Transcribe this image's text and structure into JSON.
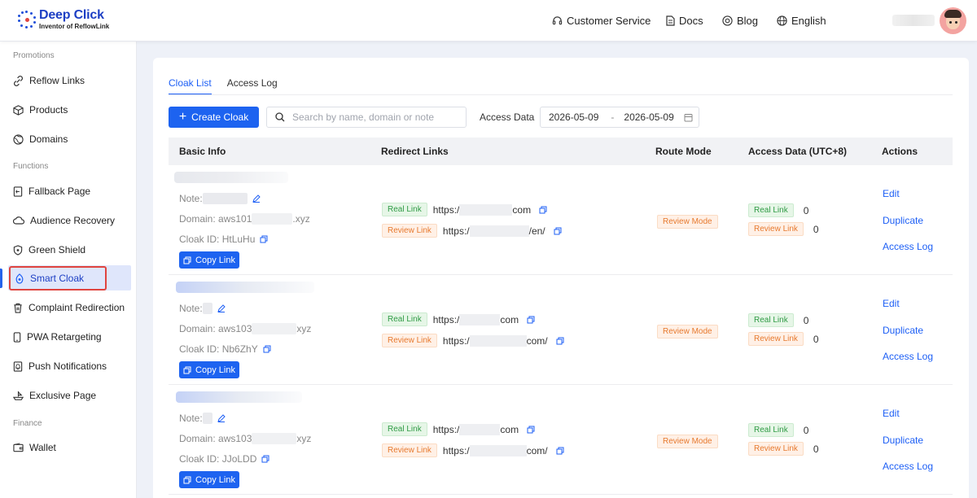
{
  "header": {
    "logo_title": "Deep Click",
    "logo_subtitle": "Inventor of ReflowLink",
    "nav": {
      "customer_service": "Customer Service",
      "docs": "Docs",
      "blog": "Blog",
      "language": "English"
    }
  },
  "sidebar": {
    "sections": {
      "promotions": "Promotions",
      "functions": "Functions",
      "finance": "Finance"
    },
    "items": [
      {
        "label": "Reflow Links",
        "icon": "link-icon"
      },
      {
        "label": "Products",
        "icon": "box-icon"
      },
      {
        "label": "Domains",
        "icon": "globe-icon"
      },
      {
        "label": "Fallback Page",
        "icon": "page-icon"
      },
      {
        "label": "Audience Recovery",
        "icon": "cloud-icon"
      },
      {
        "label": "Green Shield",
        "icon": "shield-icon"
      },
      {
        "label": "Smart Cloak",
        "icon": "cloak-icon",
        "active": true
      },
      {
        "label": "Complaint Redirection",
        "icon": "trash-icon"
      },
      {
        "label": "PWA Retargeting",
        "icon": "phone-icon"
      },
      {
        "label": "Push Notifications",
        "icon": "bell-icon"
      },
      {
        "label": "Exclusive Page",
        "icon": "ship-icon"
      },
      {
        "label": "Wallet",
        "icon": "wallet-icon"
      }
    ]
  },
  "main": {
    "tabs": [
      "Cloak List",
      "Access Log"
    ],
    "create_button": "Create Cloak",
    "search_placeholder": "Search by name, domain or note",
    "access_data_label": "Access Data",
    "date_start": "2026-05-09",
    "date_sep": "-",
    "date_end": "2026-05-09",
    "columns": [
      "Basic Info",
      "Redirect Links",
      "Route Mode",
      "Access Data (UTC+8)",
      "Actions"
    ],
    "labels": {
      "note": "Note:",
      "domain": "Domain:",
      "cloak_id": "Cloak ID:",
      "copy_link": "Copy Link",
      "real_link": "Real Link",
      "review_link": "Review Link",
      "route_mode": "Review Mode",
      "edit": "Edit",
      "duplicate": "Duplicate",
      "access_log": "Access Log"
    },
    "rows": [
      {
        "domain_prefix": "aws101",
        "domain_suffix": ".xyz",
        "cloak_id": "HtLuHu",
        "real_url_prefix": "https:/",
        "real_url_suffix": "com",
        "review_url_prefix": "https:/",
        "review_url_suffix": "/en/",
        "real_count": "0",
        "review_count": "0"
      },
      {
        "domain_prefix": "aws103",
        "domain_suffix": "xyz",
        "cloak_id": "Nb6ZhY",
        "real_url_prefix": "https:/",
        "real_url_suffix": "com",
        "review_url_prefix": "https:/",
        "review_url_suffix": "com/",
        "real_count": "0",
        "review_count": "0"
      },
      {
        "domain_prefix": "aws103",
        "domain_suffix": "xyz",
        "cloak_id": "JJoLDD",
        "real_url_prefix": "https:/",
        "real_url_suffix": "com",
        "review_url_prefix": "https:/",
        "review_url_suffix": "com/",
        "real_count": "0",
        "review_count": "0"
      }
    ]
  },
  "colors": {
    "accent": "#1d63f0",
    "active_border": "#e0443f",
    "tag_green": "#2f9b45",
    "tag_orange": "#e77a2f"
  }
}
